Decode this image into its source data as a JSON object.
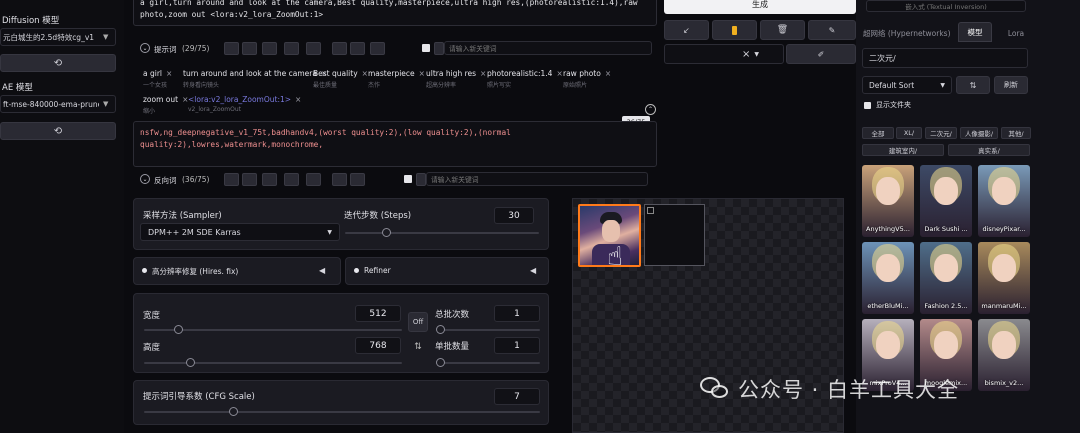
{
  "left": {
    "sd_model_title": "Diffusion 模型",
    "sd_model_value": "元白城生的2.5d特效cg_v1",
    "vae_title": "AE 模型",
    "vae_value": "ft-mse-840000-ema-pruned"
  },
  "prompt": {
    "text": "a girl,turn around and look at the camera,Best quality,masterpiece,ultra high res,(photorealistic:1.4),raw photo,zoom out <lora:v2_lora_ZoomOut:1>",
    "section_label": "提示词",
    "counter": "(29/75)",
    "keyword_placeholder": "请输入新关键词",
    "tags": [
      {
        "en": "a girl",
        "zh": "一个女孩"
      },
      {
        "en": "turn around and look at the camera",
        "zh": "转身看向镜头"
      },
      {
        "en": "Best quality",
        "zh": "最佳质量"
      },
      {
        "en": "masterpiece",
        "zh": "杰作"
      },
      {
        "en": "ultra high res",
        "zh": "超高分辨率"
      },
      {
        "en": "photorealistic:1.4",
        "zh": "照片写实"
      },
      {
        "en": "raw photo",
        "zh": "原始照片"
      },
      {
        "en": "zoom out",
        "zh": "缩小"
      },
      {
        "en": "<lora:v2_lora_ZoomOut:1>",
        "zh": "v2_lora_ZoomOut"
      }
    ]
  },
  "negative": {
    "text": "nsfw,ng_deepnegative_v1_75t,badhandv4,(worst quality:2),(low quality:2),(normal quality:2),lowres,watermark,monochrome,",
    "token_count": "36/75",
    "section_label": "反向词",
    "counter": "(36/75)",
    "keyword_placeholder": "请输入新关键词"
  },
  "actions": {
    "generate_label": "生成",
    "style_value": "×"
  },
  "params": {
    "sampler_label": "采样方法 (Sampler)",
    "sampler_value": "DPM++ 2M SDE Karras",
    "steps_label": "迭代步数 (Steps)",
    "steps_value": "30",
    "steps_fraction": 0.2,
    "hires_label": "高分辨率修复 (Hires. fix)",
    "refiner_label": "Refiner",
    "width_label": "宽度",
    "width_value": "512",
    "width_fraction": 0.12,
    "height_label": "高度",
    "height_value": "768",
    "height_fraction": 0.17,
    "batch_count_label": "总批次数",
    "batch_count_value": "1",
    "batch_count_fraction": 0.0,
    "batch_size_label": "单批数量",
    "batch_size_value": "1",
    "batch_size_fraction": 0.0,
    "swap_label": "Off",
    "cfg_label": "提示词引导系数 (CFG Scale)",
    "cfg_value": "7",
    "cfg_fraction": 0.22
  },
  "right": {
    "top_field": "嵌入式 (Textual Inversion)",
    "tabs": [
      "超网络 (Hypernetworks)",
      "模型",
      "Lora"
    ],
    "folder_value": "二次元/",
    "sort_value": "Default Sort",
    "refresh_label": "刷新",
    "show_dirs_label": "显示文件夹",
    "filters": [
      "全部",
      "XL/",
      "二次元/",
      "人像摄影/",
      "其他/",
      "建筑室内/",
      "真实系/"
    ],
    "cards": [
      {
        "name": "AnythingV5...",
        "bg": "#c9a27a"
      },
      {
        "name": "Dark Sushi ...",
        "bg": "#3d4a66"
      },
      {
        "name": "disneyPixar...",
        "bg": "#7a9ab8"
      },
      {
        "name": "etherBluMi...",
        "bg": "#6d93b8"
      },
      {
        "name": "Fashion 2.5...",
        "bg": "#4f6e8a"
      },
      {
        "name": "manmaruMi...",
        "bg": "#a88a5c"
      },
      {
        "name": "mixProV4...",
        "bg": "#b6b0bc"
      },
      {
        "name": "mooglemix...",
        "bg": "#b38a8a"
      },
      {
        "name": "bismix_v2...",
        "bg": "#8a8a8e"
      }
    ]
  },
  "watermark": {
    "text": "公众号 · 白羊工具大全"
  },
  "colors": {
    "accent": "#ff7a1a",
    "panel": "#1b1b22",
    "background": "#0b0b0f"
  }
}
